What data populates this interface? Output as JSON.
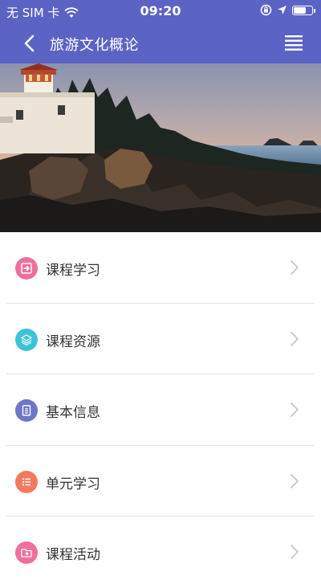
{
  "status_bar": {
    "carrier": "无 SIM 卡",
    "time": "09:20",
    "battery_level": 0.7
  },
  "navbar": {
    "back_icon": "chevron-left-icon",
    "title": "旅游文化概论",
    "menu_icon": "hamburger-menu-icon"
  },
  "banner": {
    "image": "lighthouse-on-rocky-coast-at-sunset"
  },
  "menu": {
    "items": [
      {
        "label": "课程学习",
        "icon": "enter-box-icon",
        "color": "#ef6f9b"
      },
      {
        "label": "课程资源",
        "icon": "layers-icon",
        "color": "#3cc4d6"
      },
      {
        "label": "基本信息",
        "icon": "document-icon",
        "color": "#6e76c6"
      },
      {
        "label": "单元学习",
        "icon": "list-icon",
        "color": "#f37a5e"
      },
      {
        "label": "课程活动",
        "icon": "folder-icon",
        "color": "#ef6f9b"
      }
    ]
  },
  "colors": {
    "header": "#5b63c4",
    "divider": "#e3e3e3",
    "chevron": "#c7c7c7"
  }
}
